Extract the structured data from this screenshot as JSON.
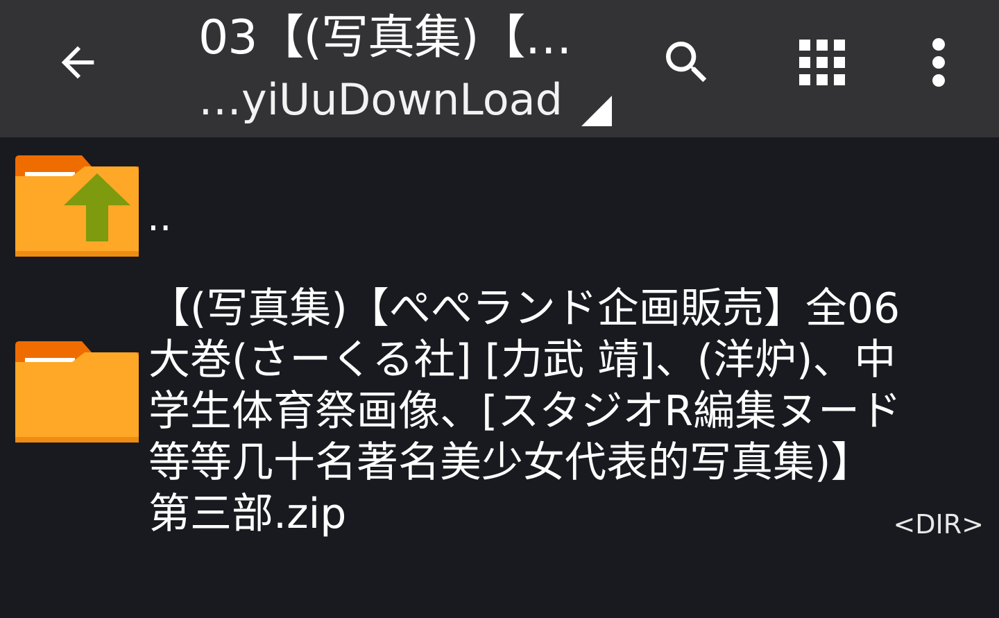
{
  "toolbar": {
    "title": "03【(写真集)【…",
    "subtitle": "…yiUuDownLoad",
    "icons": {
      "back": "arrow-left-icon",
      "search": "search-icon",
      "grid": "grid-view-icon",
      "more": "more-vert-icon"
    }
  },
  "list": {
    "items": [
      {
        "name": "..",
        "type": "parent"
      },
      {
        "name": "【(写真集)【ぺぺランド企画販売】全06大巻(さーくる社] [力武 靖]、(洋炉)、中学生体育祭画像、[スタジオR編集ヌード 等等几十名著名美少女代表的写真集)】第三部.zip",
        "tag": "<DIR>",
        "type": "dir"
      }
    ]
  },
  "colors": {
    "toolbar_bg": "#333335",
    "list_bg": "#181a1f",
    "folder_body": "#ffa726",
    "folder_tab": "#ef6c00",
    "up_arrow": "#7e9a0f"
  }
}
